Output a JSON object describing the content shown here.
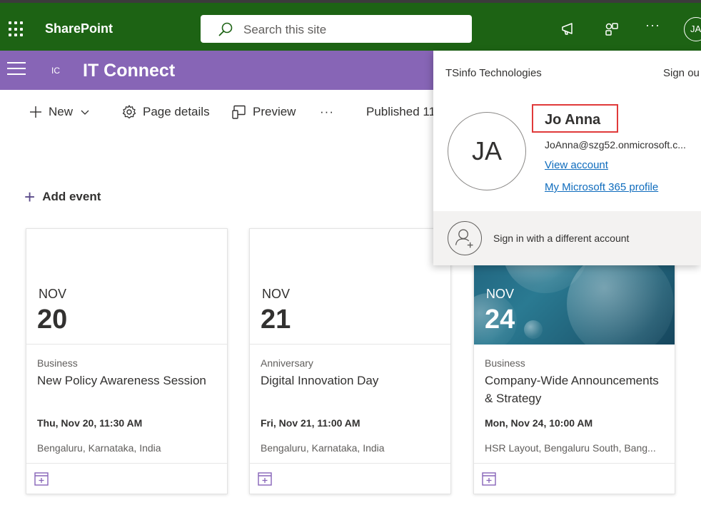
{
  "suite": {
    "app_name": "SharePoint",
    "search_placeholder": "Search this site",
    "more": "···",
    "avatar_initials": "JA"
  },
  "site": {
    "icon_text": "IC",
    "title": "IT Connect"
  },
  "commands": {
    "new": "New",
    "page_details": "Page details",
    "preview": "Preview",
    "more": "···",
    "published": "Published 11"
  },
  "add_event": "Add event",
  "events": [
    {
      "month": "NOV",
      "day": "20",
      "category": "Business",
      "title": "New Policy Awareness Session",
      "when": "Thu, Nov 20, 11:30 AM",
      "where": "Bengaluru, Karnataka, India"
    },
    {
      "month": "NOV",
      "day": "21",
      "category": "Anniversary",
      "title": "Digital Innovation Day",
      "when": "Fri, Nov 21, 11:00 AM",
      "where": "Bengaluru, Karnataka, India"
    },
    {
      "month": "NOV",
      "day": "24",
      "category": "Business",
      "title": "Company-Wide Announcements & Strategy",
      "when": "Mon, Nov 24, 10:00 AM",
      "where": "HSR Layout, Bengaluru South, Bang..."
    }
  ],
  "account": {
    "org": "TSinfo Technologies",
    "sign_out": "Sign ou",
    "initials": "JA",
    "name": "Jo Anna",
    "email": "JoAnna@szg52.onmicrosoft.c...",
    "view_account": "View account",
    "profile": "My Microsoft 365 profile",
    "sign_in_other": "Sign in with a different account"
  },
  "colors": {
    "suite_bar": "#1d6314",
    "site_header": "#8765b6",
    "link": "#0f6cbd",
    "highlight": "#e03a3a"
  }
}
